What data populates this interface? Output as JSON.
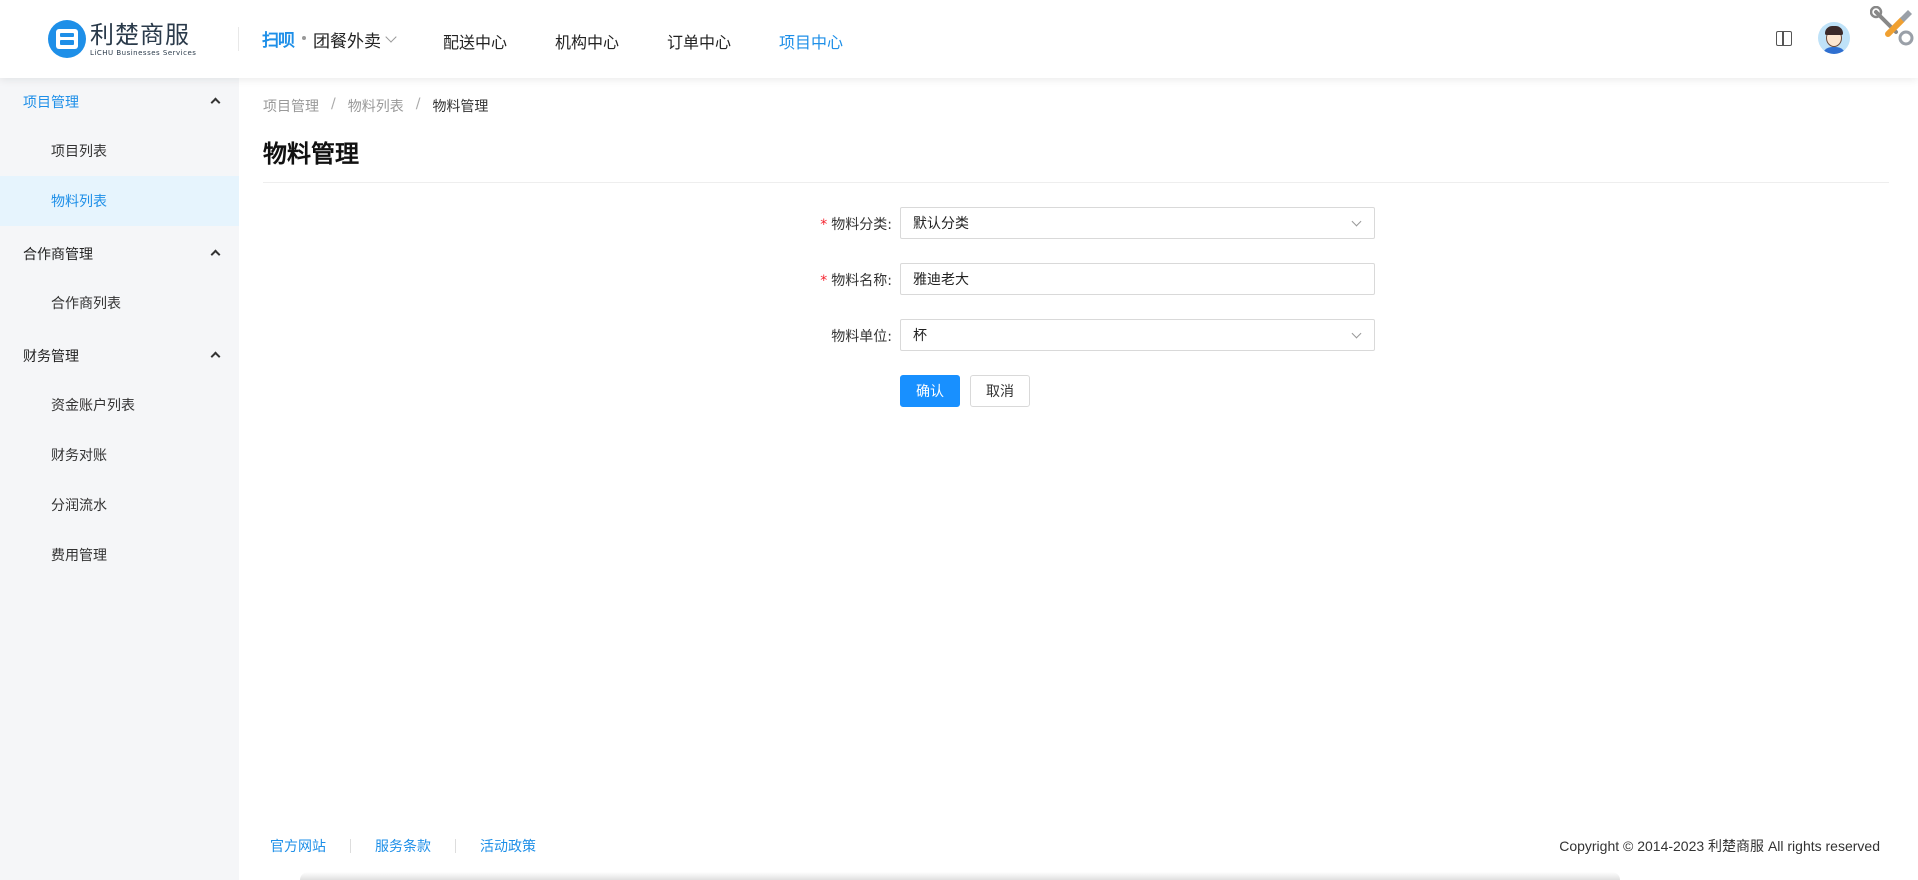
{
  "header": {
    "logo": {
      "title": "利楚商服",
      "subtitle": "LiCHU Businesses Services"
    },
    "brand_mini": "扫呗",
    "nav_dropdown": "团餐外卖",
    "nav": [
      "配送中心",
      "机构中心",
      "订单中心",
      "项目中心"
    ],
    "active_nav": "项目中心"
  },
  "sidebar": {
    "groups": [
      {
        "label": "项目管理",
        "items": [
          "项目列表",
          "物料列表"
        ]
      },
      {
        "label": "合作商管理",
        "items": [
          "合作商列表"
        ]
      },
      {
        "label": "财务管理",
        "items": [
          "资金账户列表",
          "财务对账",
          "分润流水",
          "费用管理"
        ]
      }
    ],
    "active_item": "物料列表"
  },
  "breadcrumb": [
    "项目管理",
    "物料列表",
    "物料管理"
  ],
  "page_title": "物料管理",
  "form": {
    "category": {
      "label": "物料分类:",
      "value": "默认分类",
      "required": true
    },
    "name": {
      "label": "物料名称:",
      "value": "雅迪老大",
      "required": true
    },
    "unit": {
      "label": "物料单位:",
      "value": "杯",
      "required": false
    },
    "confirm": "确认",
    "cancel": "取消"
  },
  "footer": {
    "links": [
      "官方网站",
      "服务条款",
      "活动政策"
    ],
    "copyright": "Copyright © 2014-2023 利楚商服 All rights reserved"
  },
  "colors": {
    "accent": "#1890ff",
    "link": "#1e8fe8",
    "required": "#f5222d",
    "sidebar_bg": "#f5f6f8",
    "active_bg": "#e6f4fd"
  }
}
